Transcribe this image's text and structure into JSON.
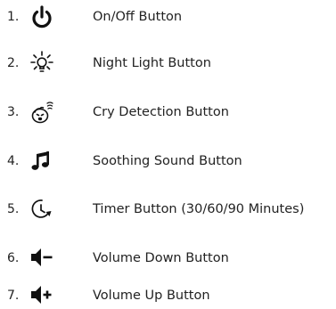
{
  "items": [
    {
      "number": "1.",
      "icon": "power-icon",
      "label": "On/Off Button"
    },
    {
      "number": "2.",
      "icon": "light-bulb-icon",
      "label": "Night Light Button"
    },
    {
      "number": "3.",
      "icon": "crying-baby-icon",
      "label": "Cry Detection Button"
    },
    {
      "number": "4.",
      "icon": "music-note-icon",
      "label": "Soothing Sound Button"
    },
    {
      "number": "5.",
      "icon": "timer-icon",
      "label": "Timer Button (30/60/90 Minutes)"
    },
    {
      "number": "6.",
      "icon": "volume-down-icon",
      "label": "Volume Down Button"
    },
    {
      "number": "7.",
      "icon": "volume-up-icon",
      "label": "Volume Up Button"
    }
  ]
}
